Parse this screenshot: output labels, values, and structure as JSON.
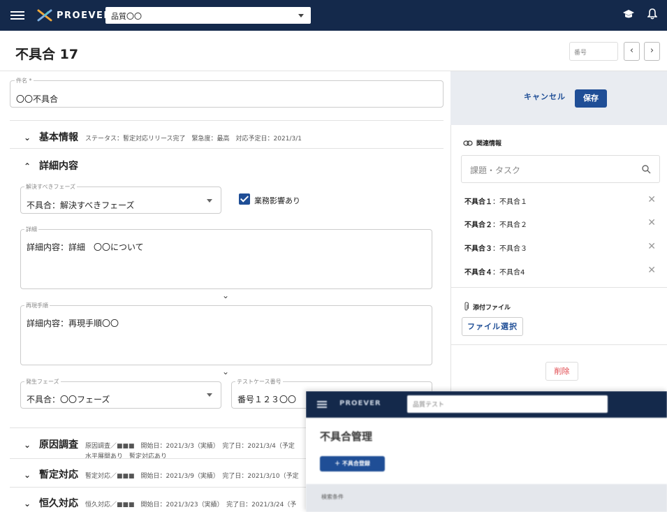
{
  "appbar": {
    "logo_text": "PROEVER",
    "project_select": "品質〇〇"
  },
  "header": {
    "title": "不具合 17",
    "number_placeholder": "番号",
    "prev": "‹",
    "next": "›"
  },
  "form": {
    "subject_label": "件名 *",
    "subject_value": "〇〇不具合",
    "basic": {
      "chevron": "⌄",
      "title": "基本情報",
      "meta": "ステータス：暫定対応リリース完了　緊急度：最高　対応予定日：2021/3/1"
    },
    "detail": {
      "chevron": "⌃",
      "title": "詳細内容",
      "phase_label": "解決すべきフェーズ",
      "phase_value": "不具合：解決すべきフェーズ",
      "impact_label": "業務影響あり",
      "detail_label": "詳細",
      "detail_value": "詳細内容：詳細　〇〇について",
      "repro_label": "再現手順",
      "repro_value": "詳細内容：再現手順〇〇",
      "occur_label": "発生フェーズ",
      "occur_value": "不具合：〇〇フェーズ",
      "testcase_label": "テストケース番号",
      "testcase_value": "番号１２３〇〇"
    },
    "sections": [
      {
        "chevron": "⌄",
        "title": "原因調査",
        "meta1": "原因調査／■■■　開始日：2021/3/3（実績）　完了日：2021/3/4（予定",
        "meta2": "水平展開あり　暫定対応あり"
      },
      {
        "chevron": "⌄",
        "title": "暫定対応",
        "meta1": "暫定対応／■■■　開始日：2021/3/9（実績）　完了日：2021/3/10（予定"
      },
      {
        "chevron": "⌄",
        "title": "恒久対応",
        "meta1": "恒久対応／■■■　開始日：2021/3/23（実績）　完了日：2021/3/24（予"
      }
    ]
  },
  "panel": {
    "cancel": "キャンセル",
    "save": "保存",
    "related_heading": "関連情報",
    "task_search_placeholder": "課題・タスク",
    "related_items": [
      {
        "key": "不具合１",
        "name": "：不具合１"
      },
      {
        "key": "不具合２",
        "name": "：不具合２"
      },
      {
        "key": "不具合３",
        "name": "：不具合３"
      },
      {
        "key": "不具合４",
        "name": "：不具合4"
      }
    ],
    "attach_heading": "添付ファイル",
    "file_select": "ファイル選択",
    "delete": "削除"
  },
  "overlay": {
    "logo_text": "PROEVER",
    "select_text": "品質テスト",
    "title": "不具合管理",
    "button": "＋ 不具合登録",
    "band_text": "検索条件"
  },
  "colors": {
    "appbar": "#14294b",
    "primary": "#1f4e96",
    "danger": "#e0474c",
    "panel_bg": "#e9ecf1"
  }
}
